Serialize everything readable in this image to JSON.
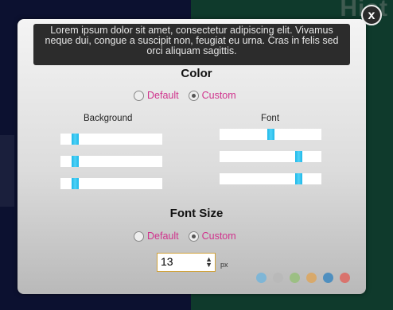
{
  "background": {
    "title_fragment": "Hist"
  },
  "dialog": {
    "close_label": "x",
    "preview_text": "Lorem ipsum dolor sit amet, consectetur adipiscing elit. Vivamus neque dui, congue a suscipit non, feugiat eu urna. Cras in felis sed orci aliquam sagittis."
  },
  "color_section": {
    "heading": "Color",
    "options": [
      {
        "label": "Default",
        "selected": false
      },
      {
        "label": "Custom",
        "selected": true
      }
    ],
    "background_label": "Background",
    "font_label": "Font",
    "background_sliders": [
      0.12,
      0.12,
      0.12
    ],
    "font_sliders": [
      0.5,
      0.8,
      0.8
    ],
    "thumb_color": "#1fb8e8",
    "label_color": "#d0338d"
  },
  "font_size_section": {
    "heading": "Font Size",
    "options": [
      {
        "label": "Default",
        "selected": false
      },
      {
        "label": "Custom",
        "selected": true
      }
    ],
    "value": "13",
    "unit": "px"
  },
  "swatches": [
    "#7fb6d6",
    "#b9b9b9",
    "#9cbf84",
    "#d8a96b",
    "#4f8fbf",
    "#d9736d"
  ]
}
